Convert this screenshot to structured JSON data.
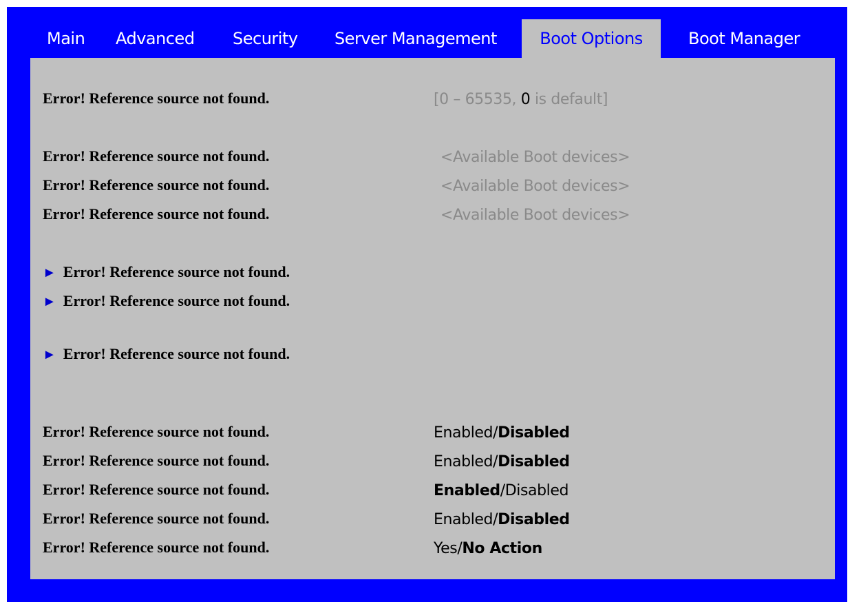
{
  "tabs": [
    {
      "label": "Main"
    },
    {
      "label": "Advanced"
    },
    {
      "label": "Security"
    },
    {
      "label": "Server Management"
    },
    {
      "label": "Boot Options",
      "active": true
    },
    {
      "label": "Boot Manager"
    }
  ],
  "rows": {
    "timeout": {
      "label": "Error! Reference source not found.",
      "value_prefix": "[0 – 65535, ",
      "value_hl": "0",
      "value_suffix": " is default]"
    },
    "boot1": {
      "label": "Error! Reference source not found.",
      "value": "<Available Boot devices>"
    },
    "boot2": {
      "label": "Error! Reference source not found.",
      "value": "<Available Boot devices>"
    },
    "boot3": {
      "label": "Error! Reference source not found.",
      "value": "<Available Boot devices>"
    },
    "sub1": {
      "label": "Error! Reference source not found."
    },
    "sub2": {
      "label": "Error! Reference source not found."
    },
    "sub3": {
      "label": "Error! Reference source not found."
    },
    "opt1": {
      "label": "Error! Reference source not found.",
      "a": "Enabled",
      "sep": "/",
      "b": "Disabled",
      "selected": "b"
    },
    "opt2": {
      "label": "Error! Reference source not found.",
      "a": "Enabled",
      "sep": "/",
      "b": "Disabled",
      "selected": "b"
    },
    "opt3": {
      "label": "Error! Reference source not found.",
      "a": "Enabled",
      "sep": "/",
      "b": "Disabled",
      "selected": "a"
    },
    "opt4": {
      "label": "Error! Reference source not found.",
      "a": "Enabled",
      "sep": "/",
      "b": "Disabled",
      "selected": "b"
    },
    "opt5": {
      "label": "Error! Reference source not found.",
      "a": "Yes",
      "sep": "/",
      "b": "No Action",
      "selected": "b"
    }
  },
  "submenu_arrow": "►",
  "colors": {
    "frame": "#0000ff",
    "panel": "#c0c0c0",
    "tab_text": "#ffffff",
    "active_tab_text": "#0000ff",
    "disabled_value": "#8a8a8a",
    "arrow": "#0000cc"
  }
}
